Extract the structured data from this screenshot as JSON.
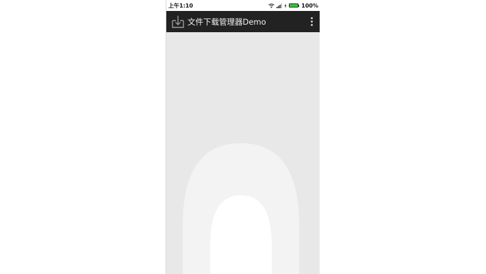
{
  "status_bar": {
    "time": "上午1:10",
    "battery_percent": "100%",
    "icons": [
      "wifi-icon",
      "signal-icon",
      "charge-icon",
      "battery-icon"
    ]
  },
  "action_bar": {
    "app_icon": "download-icon",
    "title": "文件下载管理器Demo",
    "menu_icon": "overflow-menu-icon"
  },
  "colors": {
    "action_bar_bg": "#222222",
    "content_bg": "#e8e8e8",
    "placeholder_shape": "#f3f3f3"
  }
}
